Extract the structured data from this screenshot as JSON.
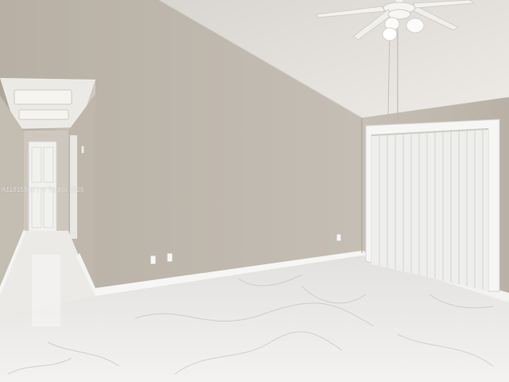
{
  "watermark": {
    "text": "A11815503 | Al Rights 2025"
  },
  "colors": {
    "wall": "#bcb5ab",
    "wall_light": "#c8c2b9",
    "ceiling": "#e6e3df",
    "floor": "#e9e8e6",
    "trim": "#f4f4f2",
    "door": "#eeeeec"
  },
  "icons": [
    "ceiling-fan-icon"
  ]
}
